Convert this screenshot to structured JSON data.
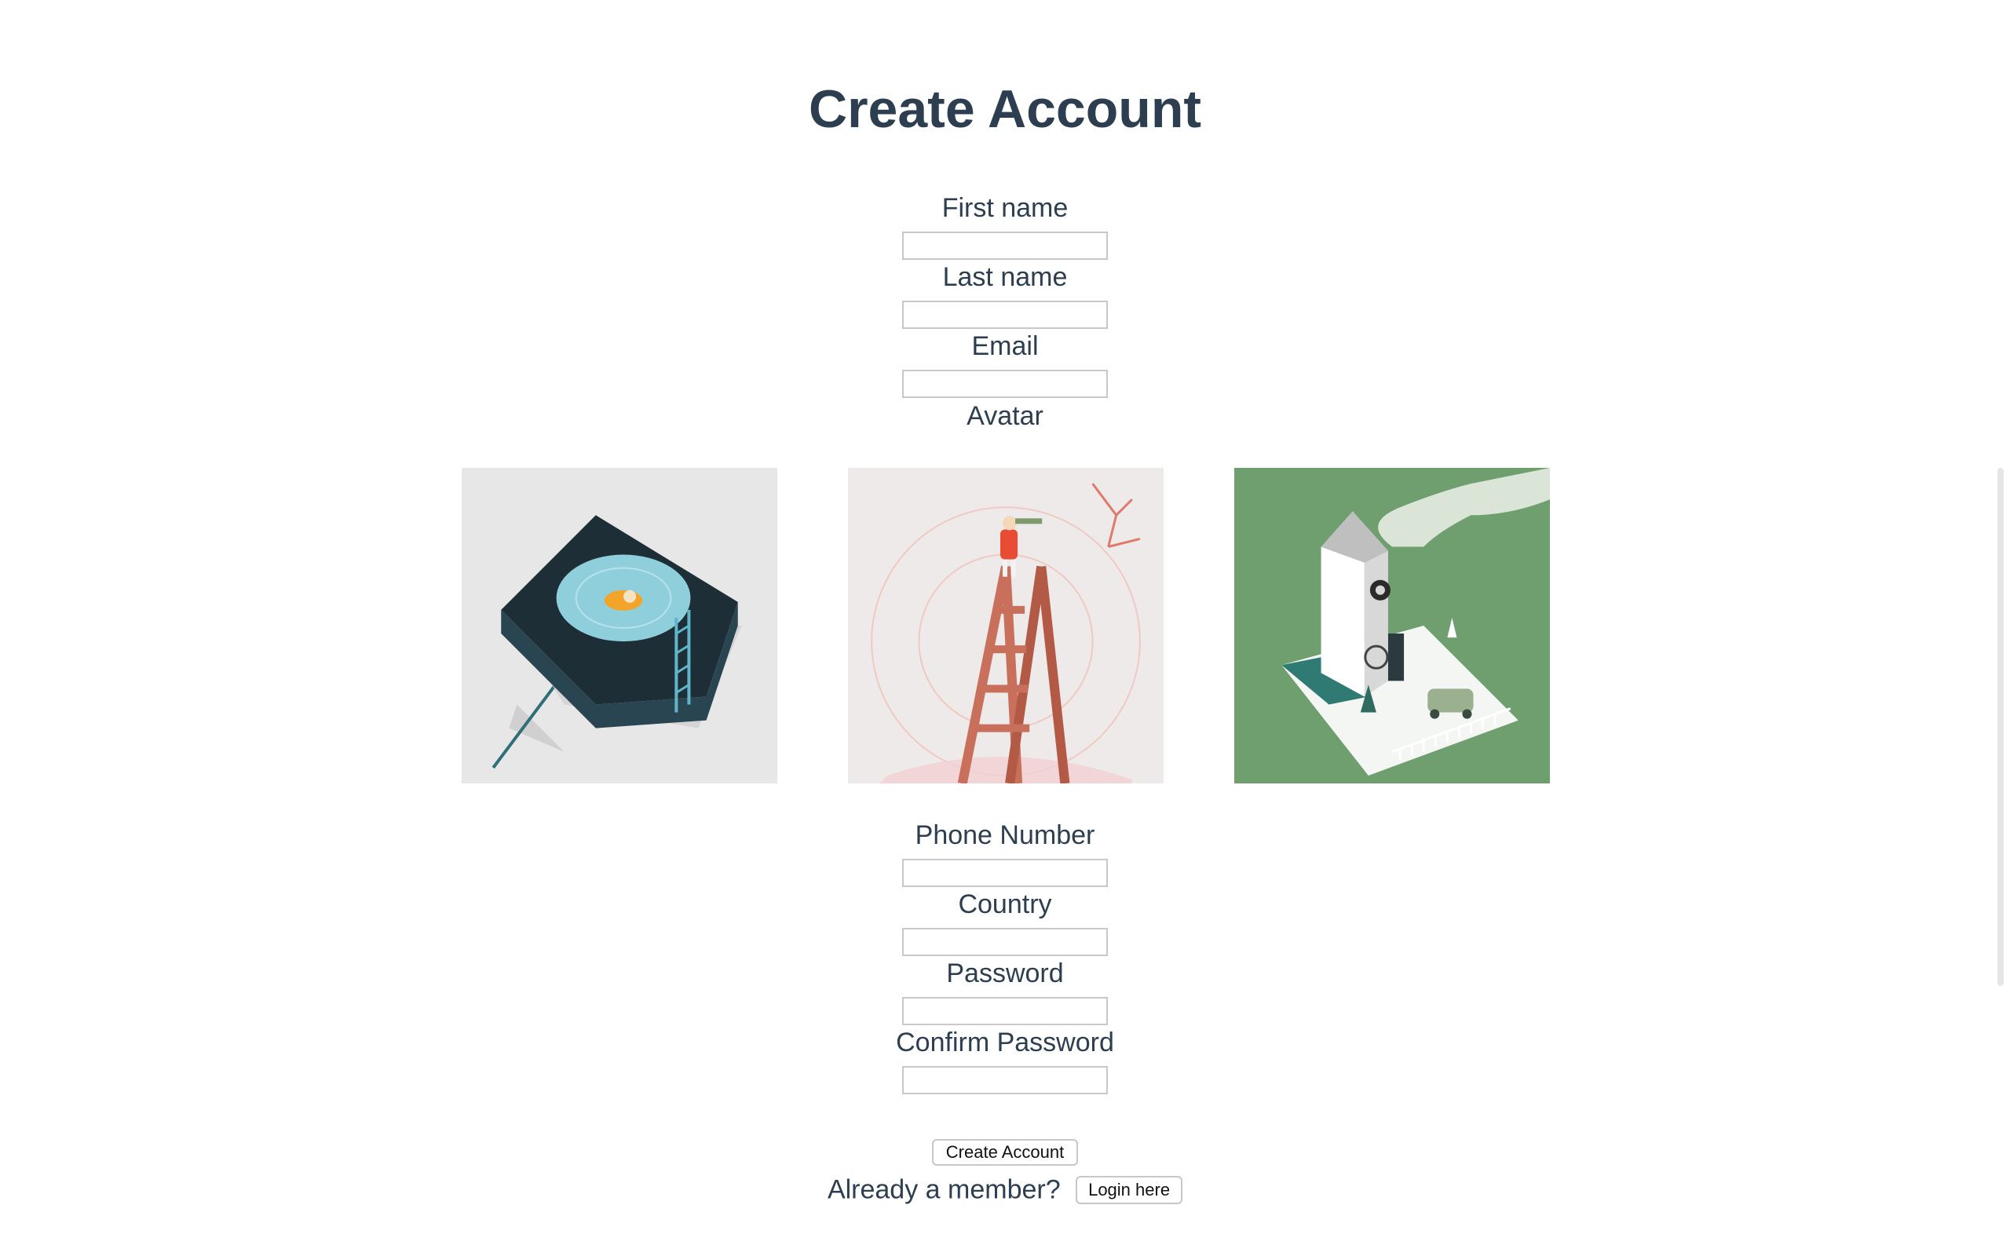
{
  "page": {
    "title": "Create Account"
  },
  "form": {
    "first_name": {
      "label": "First name",
      "value": ""
    },
    "last_name": {
      "label": "Last name",
      "value": ""
    },
    "email": {
      "label": "Email",
      "value": ""
    },
    "avatar": {
      "label": "Avatar",
      "options": [
        "pool-island-icon",
        "ladder-telescope-icon",
        "cuckoo-house-icon"
      ]
    },
    "phone": {
      "label": "Phone Number",
      "value": ""
    },
    "country": {
      "label": "Country",
      "value": ""
    },
    "password": {
      "label": "Password",
      "value": ""
    },
    "confirm_password": {
      "label": "Confirm Password",
      "value": ""
    },
    "submit_label": "Create Account"
  },
  "footer": {
    "member_text": "Already a member?",
    "login_label": "Login here"
  },
  "colors": {
    "heading": "#2c3e50",
    "input_border": "#c8c8c8",
    "green": "#6f9d6e"
  }
}
